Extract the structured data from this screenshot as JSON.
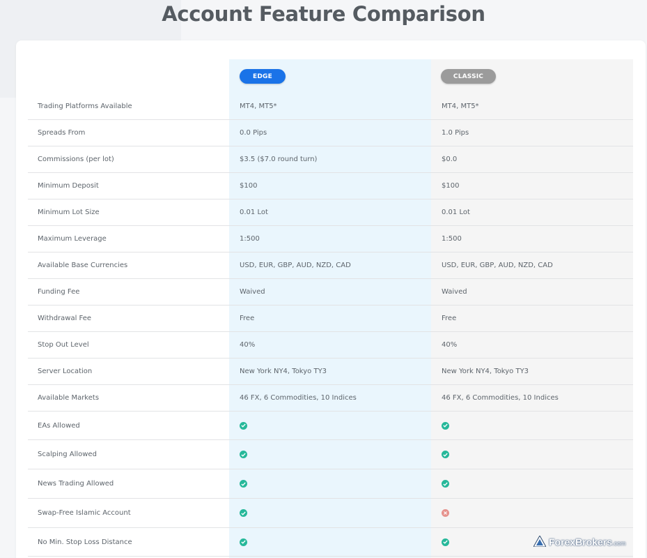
{
  "page_title": "Account Feature Comparison",
  "columns": {
    "edge": {
      "label": "EDGE",
      "color": "#1a73e8"
    },
    "classic": {
      "label": "CLASSIC",
      "color": "#9b9b9b"
    }
  },
  "rows": [
    {
      "label": "Trading Platforms Available",
      "edge": "MT4, MT5*",
      "classic": "MT4, MT5*"
    },
    {
      "label": "Spreads From",
      "edge": "0.0 Pips",
      "classic": "1.0 Pips"
    },
    {
      "label": "Commissions (per lot)",
      "edge": "$3.5 ($7.0 round turn)",
      "classic": "$0.0"
    },
    {
      "label": "Minimum Deposit",
      "edge": "$100",
      "classic": "$100"
    },
    {
      "label": "Minimum Lot Size",
      "edge": "0.01 Lot",
      "classic": "0.01 Lot"
    },
    {
      "label": "Maximum Leverage",
      "edge": "1:500",
      "classic": "1:500"
    },
    {
      "label": "Available Base Currencies",
      "edge": "USD, EUR, GBP, AUD, NZD, CAD",
      "classic": "USD, EUR, GBP, AUD, NZD, CAD"
    },
    {
      "label": "Funding Fee",
      "edge": "Waived",
      "classic": "Waived"
    },
    {
      "label": "Withdrawal Fee",
      "edge": "Free",
      "classic": "Free"
    },
    {
      "label": "Stop Out Level",
      "edge": "40%",
      "classic": "40%"
    },
    {
      "label": "Server Location",
      "edge": "New York NY4, Tokyo TY3",
      "classic": "New York NY4, Tokyo TY3"
    },
    {
      "label": "Available Markets",
      "edge": "46 FX, 6 Commodities, 10 Indices",
      "classic": "46 FX, 6 Commodities, 10 Indices"
    },
    {
      "label": "EAs Allowed",
      "edge_icon": "check-icon",
      "classic_icon": "check-icon"
    },
    {
      "label": "Scalping Allowed",
      "edge_icon": "check-icon",
      "classic_icon": "check-icon"
    },
    {
      "label": "News Trading Allowed",
      "edge_icon": "check-icon",
      "classic_icon": "check-icon"
    },
    {
      "label": "Swap-Free Islamic Account",
      "edge_icon": "check-icon",
      "classic_icon": "cross-icon"
    },
    {
      "label": "No Min. Stop Loss Distance",
      "edge_icon": "check-icon",
      "classic_icon": "check-icon"
    }
  ],
  "watermark": {
    "brand": "ForexBrokers",
    "suffix": ".com"
  }
}
